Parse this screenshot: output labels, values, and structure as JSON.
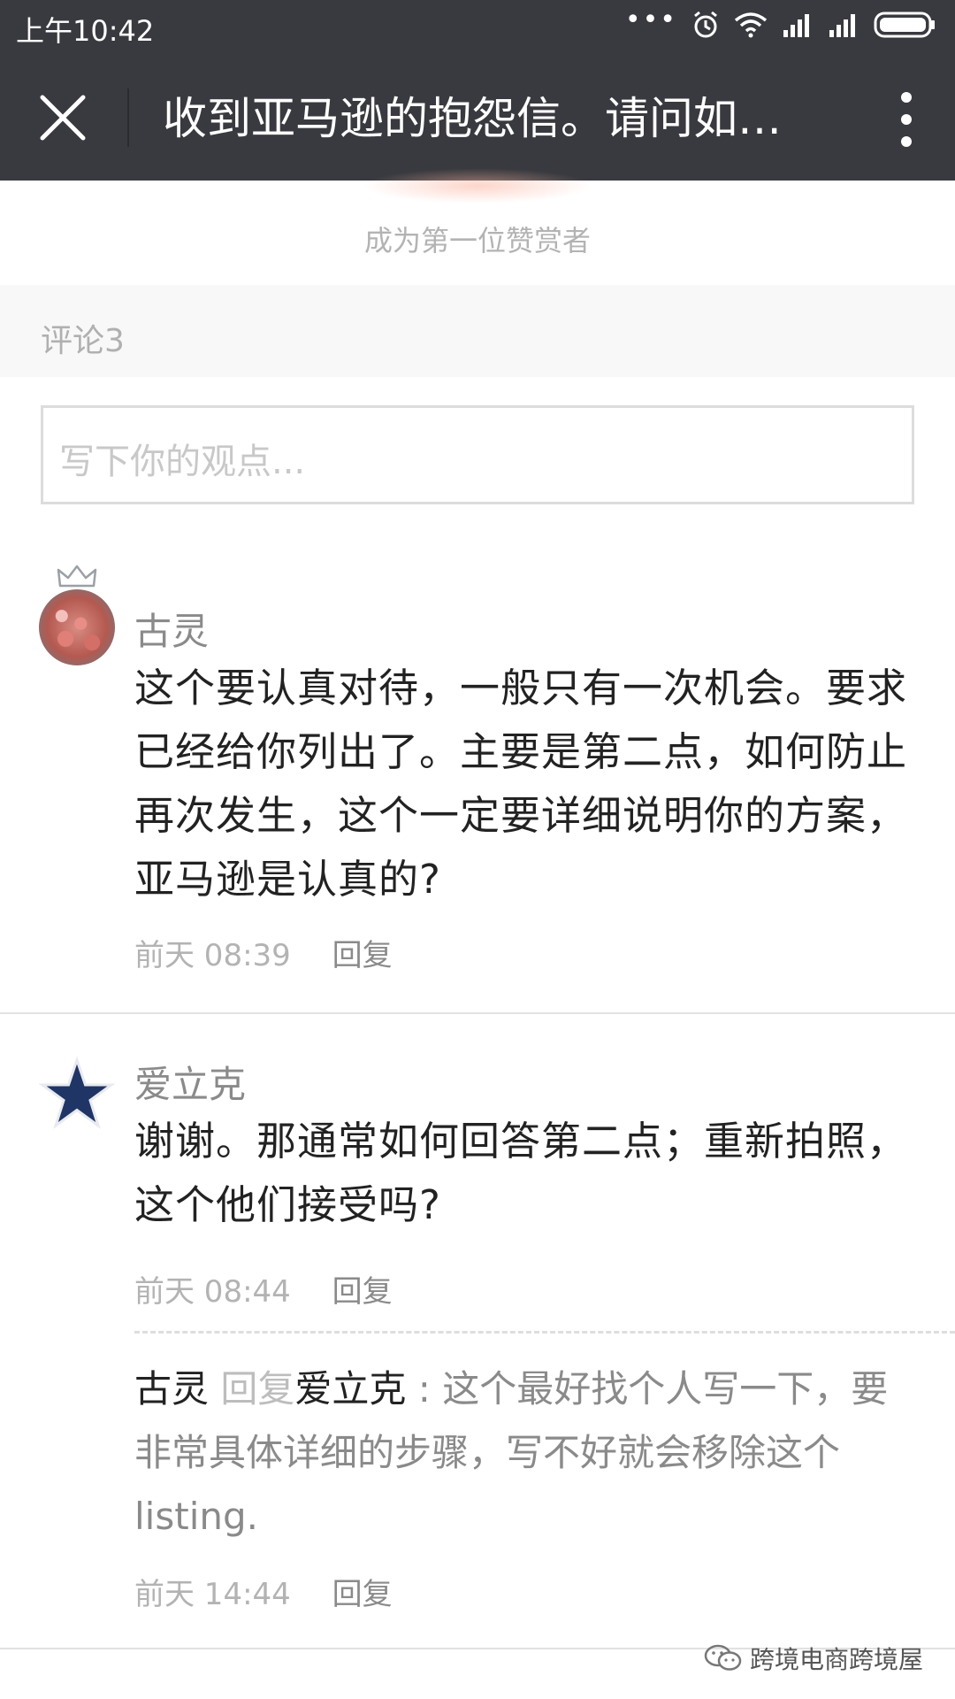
{
  "status_bar": {
    "time": "上午10:42",
    "dots": "•••",
    "icons": [
      "alarm-icon",
      "wifi-icon",
      "signal-icon",
      "signal-icon",
      "battery-icon"
    ]
  },
  "header": {
    "title": "收到亚马逊的抱怨信。请问如…",
    "close_icon": "close-icon",
    "more_icon": "more-vertical-icon"
  },
  "reward": {
    "text": "成为第一位赞赏者"
  },
  "comments_section": {
    "label": "评论3",
    "input_placeholder": "写下你的观点..."
  },
  "comments": [
    {
      "author": "古灵",
      "content": "这个要认真对待，一般只有一次机会。要求已经给你列出了。主要是第二点，如何防止再次发生，这个一定要详细说明你的方案，亚马逊是认真的?",
      "time": "前天 08:39",
      "reply_label": "回复"
    },
    {
      "author": "爱立克",
      "content": "谢谢。那通常如何回答第二点；重新拍照，这个他们接受吗?",
      "time": "前天 08:44",
      "reply_label": "回复",
      "replies": [
        {
          "author": "古灵",
          "reply_word": "回复",
          "target": "爱立克",
          "separator": " : ",
          "content": "这个最好找个人写一下，要非常具体详细的步骤，写不好就会移除这个listing.",
          "time": "前天 14:44",
          "reply_label": "回复"
        }
      ]
    }
  ],
  "watermark": {
    "text": "跨境电商跨境屋",
    "icon": "wechat-icon"
  },
  "colors": {
    "header_bg": "#393a3f",
    "muted_text": "#b3b3b3",
    "body_text": "#222222"
  }
}
